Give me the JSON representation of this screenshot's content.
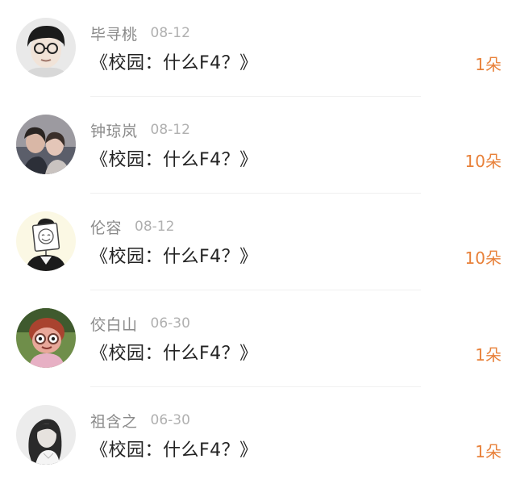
{
  "accent_color": "#e8813a",
  "items": [
    {
      "name": "毕寻桃",
      "date": "08-12",
      "title": "《校园：什么F4？》",
      "gift": "1朵",
      "avatar_icon": "avatar-man-glasses"
    },
    {
      "name": "钟琼岚",
      "date": "08-12",
      "title": "《校园：什么F4？》",
      "gift": "10朵",
      "avatar_icon": "avatar-couple-photo"
    },
    {
      "name": "伦容",
      "date": "08-12",
      "title": "《校园：什么F4？》",
      "gift": "10朵",
      "avatar_icon": "avatar-smiley-sign"
    },
    {
      "name": "佼白山",
      "date": "06-30",
      "title": "《校园：什么F4？》",
      "gift": "1朵",
      "avatar_icon": "avatar-cartoon-girl"
    },
    {
      "name": "祖含之",
      "date": "06-30",
      "title": "《校园：什么F4？》",
      "gift": "1朵",
      "avatar_icon": "avatar-woman-bw"
    }
  ]
}
